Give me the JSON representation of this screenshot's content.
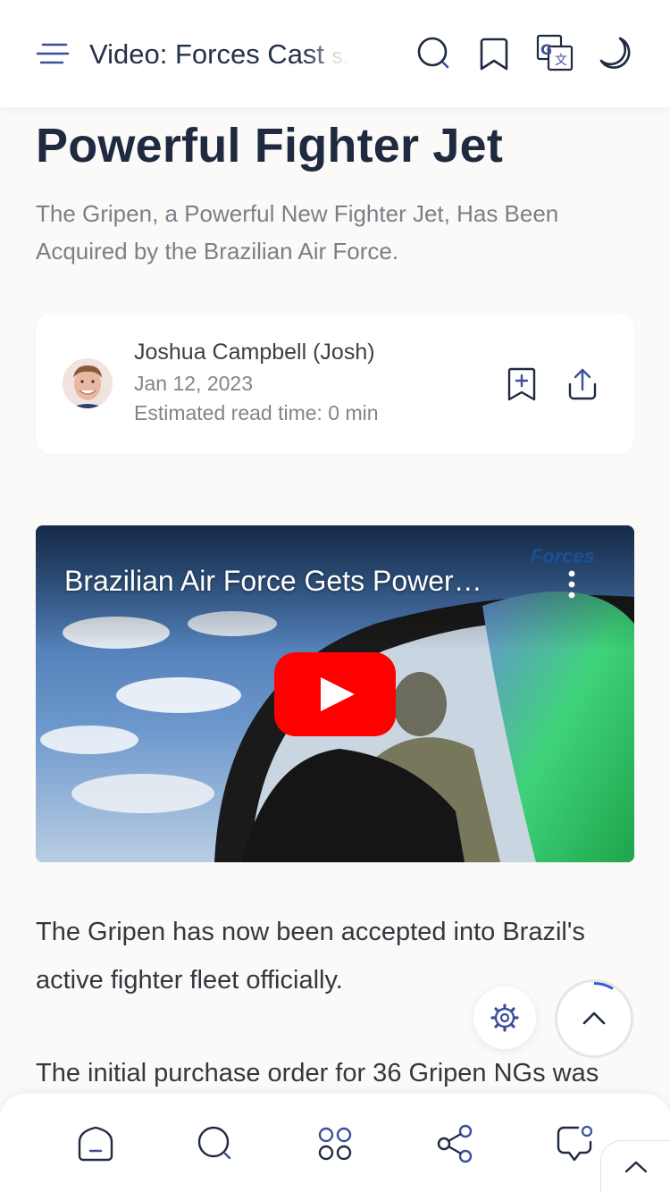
{
  "header": {
    "title": "Video: Forces Cast",
    "title_overflow": "s."
  },
  "article": {
    "headline": "Powerful Fighter Jet",
    "subtitle": "The Gripen, a Powerful New Fighter Jet, Has Been Acquired by the Brazilian Air Force.",
    "author": {
      "name": "Joshua Campbell (Josh)",
      "date": "Jan 12, 2023",
      "read_time": "Estimated read time: 0 min"
    },
    "video": {
      "title": "Brazilian Air Force Gets Power…",
      "logo_text": "Forces"
    },
    "paragraphs": [
      "The Gripen has now been accepted into Brazil's active fighter fleet officially.",
      "The initial purchase order for 36 Gripen NGs was"
    ]
  },
  "colors": {
    "accent": "#3b4f9a",
    "icon": "#1f2a40",
    "play_red": "#ff0000"
  },
  "icons": {
    "menu": "menu-icon",
    "search": "search-icon",
    "bookmark": "bookmark-icon",
    "translate": "translate-icon",
    "dark_mode": "moon-icon",
    "bookmark_add": "bookmark-add-icon",
    "share": "share-icon",
    "settings": "gear-icon",
    "scroll_top": "chevron-up-icon"
  },
  "bottom_nav": [
    "home-icon",
    "search-icon",
    "apps-icon",
    "share-nodes-icon",
    "chat-icon"
  ]
}
